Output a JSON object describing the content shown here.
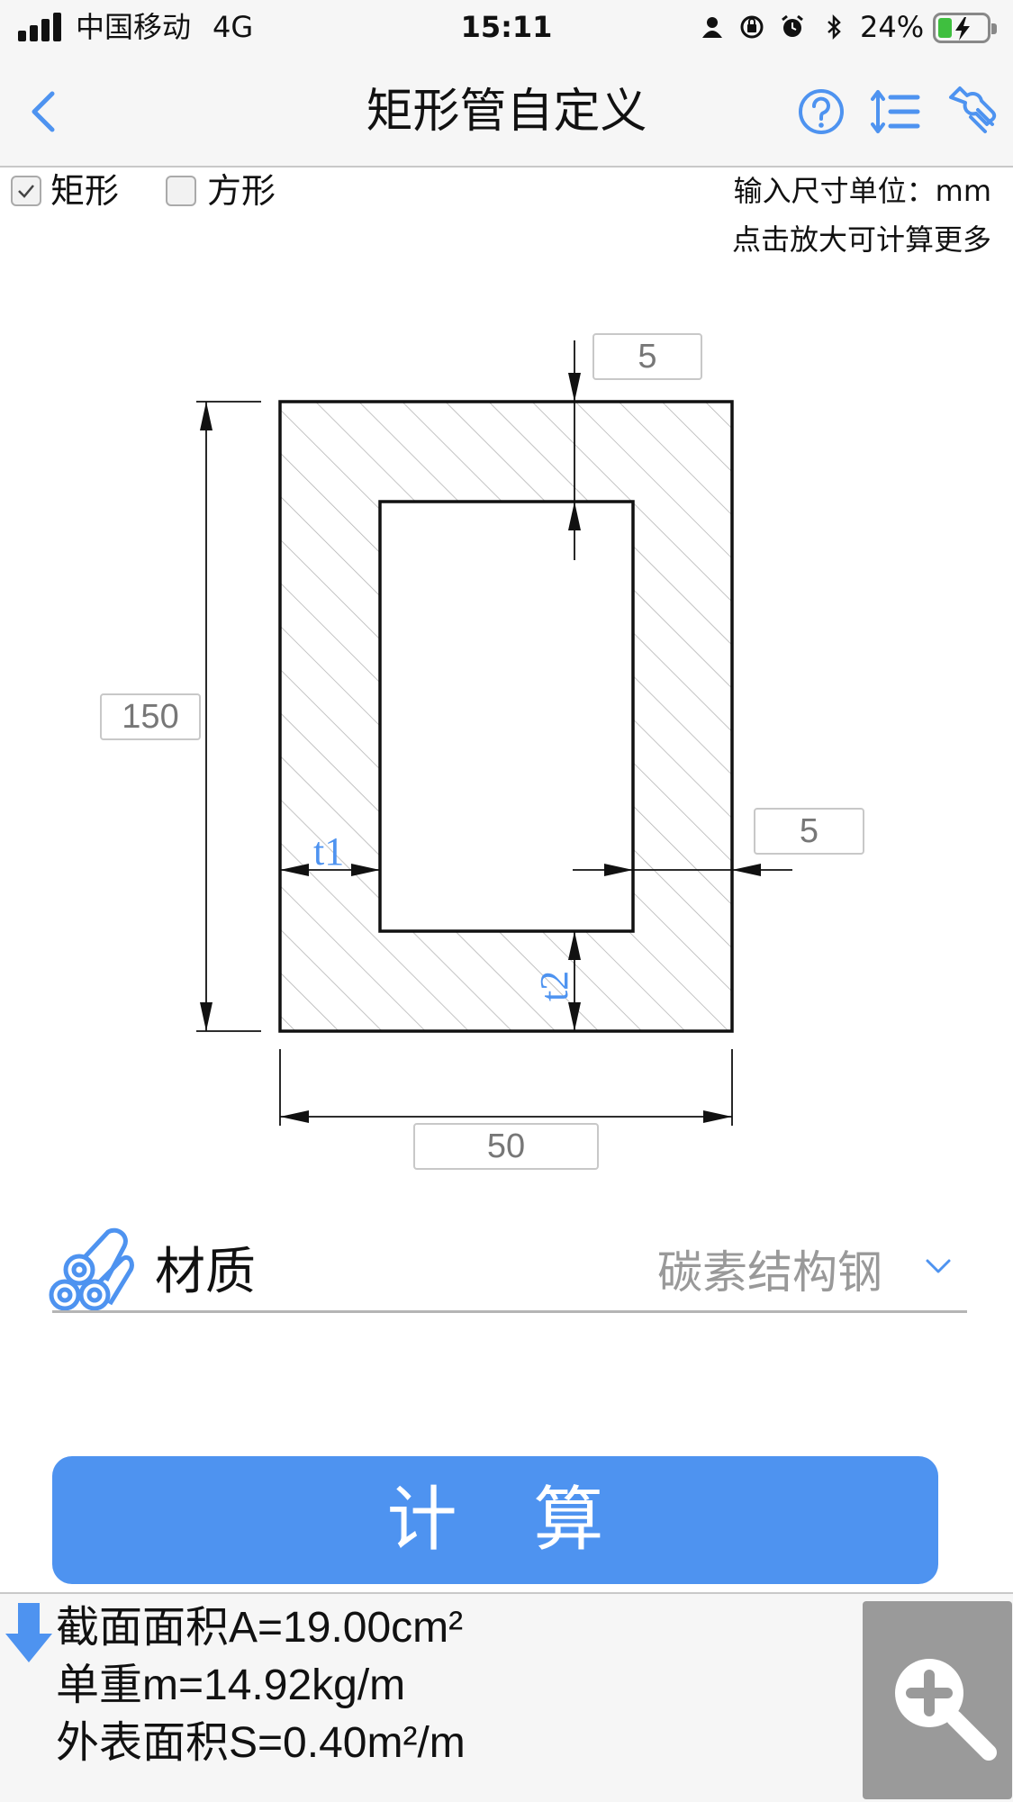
{
  "status_bar": {
    "carrier": "中国移动",
    "network": "4G",
    "time": "15:11",
    "battery_percent": "24%"
  },
  "nav": {
    "title": "矩形管自定义",
    "back_icon": "chevron-left-icon",
    "help_icon": "question-circle-icon",
    "sort_icon": "sort-list-icon",
    "settings_icon": "wrench-icon"
  },
  "options": {
    "rectangle": {
      "label": "矩形",
      "checked": true
    },
    "square": {
      "label": "方形",
      "checked": false
    },
    "unit_hint": "输入尺寸单位：mm",
    "zoom_hint": "点击放大可计算更多"
  },
  "dimensions": {
    "top_thickness": "5",
    "height": "150",
    "side_thickness": "5",
    "width": "50",
    "t1_label": "t1",
    "t2_label": "t2"
  },
  "material": {
    "label": "材质",
    "value": "碳素结构钢",
    "icon": "pipes-icon",
    "chevron": "chevron-down-icon"
  },
  "calculate_label": "计 算",
  "results": {
    "area": "截面面积A=19.00cm²",
    "unit_weight": "单重m=14.92kg/m",
    "surface_area": "外表面积S=0.40m²/m",
    "zoom_icon": "zoom-in-icon"
  },
  "colors": {
    "accent": "#4e93f0",
    "t_label": "#4e93f0",
    "result_bg": "#f6f6f6"
  }
}
